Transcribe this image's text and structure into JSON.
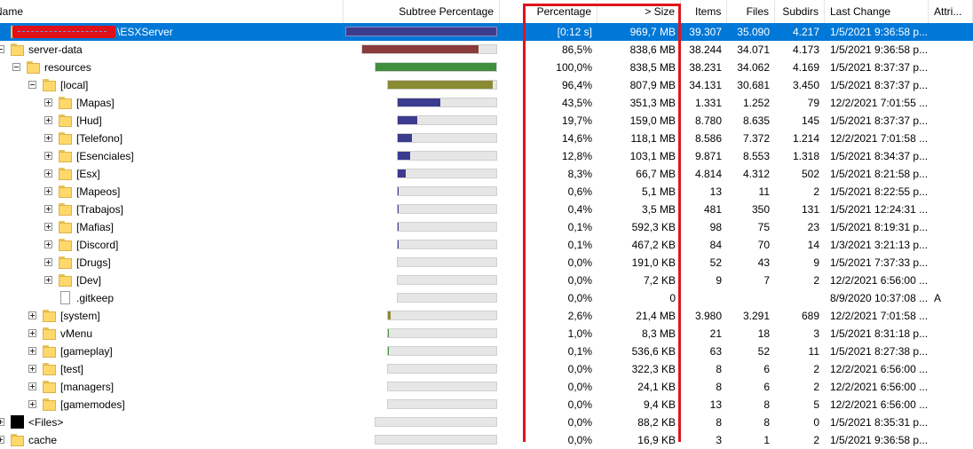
{
  "columns": {
    "name": "Name",
    "subtree": "Subtree Percentage",
    "percentage": "Percentage",
    "size": "> Size",
    "items": "Items",
    "files": "Files",
    "subdirs": "Subdirs",
    "lastchange": "Last Change",
    "attri": "Attri..."
  },
  "colors": {
    "selection": "#0078d7",
    "highlight_box": "#e0141e",
    "bar_root": "#3c3c8c",
    "bar_serverdata": "#8b3a3a",
    "bar_resources": "#3f8f3f",
    "bar_local": "#8a8a32",
    "bar_child": "#3b3b8f"
  },
  "rows": [
    {
      "name": "\\ESXServer",
      "icon": "folder-icon",
      "percentage": "[0:12 s]",
      "size": "969,7 MB",
      "items": "39.307",
      "files": "35.090",
      "subdirs": "4.217",
      "lastchange": "1/5/2021 9:36:58 p...",
      "attr": "",
      "fraction": 1.0,
      "barColor": "#3c3c8c",
      "selected": true
    },
    {
      "name": "server-data",
      "icon": "folder-icon",
      "percentage": "86,5%",
      "size": "838,6 MB",
      "items": "38.244",
      "files": "34.071",
      "subdirs": "4.173",
      "lastchange": "1/5/2021 9:36:58 p...",
      "attr": "",
      "fraction": 0.865,
      "barColor": "#8b3a3a"
    },
    {
      "name": "resources",
      "icon": "folder-icon",
      "percentage": "100,0%",
      "size": "838,5 MB",
      "items": "38.231",
      "files": "34.062",
      "subdirs": "4.169",
      "lastchange": "1/5/2021 8:37:37 p...",
      "attr": "",
      "fraction": 1.0,
      "barColor": "#3f8f3f"
    },
    {
      "name": "[local]",
      "icon": "folder-icon",
      "percentage": "96,4%",
      "size": "807,9 MB",
      "items": "34.131",
      "files": "30.681",
      "subdirs": "3.450",
      "lastchange": "1/5/2021 8:37:37 p...",
      "attr": "",
      "fraction": 0.964,
      "barColor": "#8a8a32"
    },
    {
      "name": "[Mapas]",
      "icon": "folder-icon",
      "percentage": "43,5%",
      "size": "351,3 MB",
      "items": "1.331",
      "files": "1.252",
      "subdirs": "79",
      "lastchange": "12/2/2021 7:01:55 ...",
      "attr": "",
      "fraction": 0.435,
      "barColor": "#3b3b8f"
    },
    {
      "name": "[Hud]",
      "icon": "folder-icon",
      "percentage": "19,7%",
      "size": "159,0 MB",
      "items": "8.780",
      "files": "8.635",
      "subdirs": "145",
      "lastchange": "1/5/2021 8:37:37 p...",
      "attr": "",
      "fraction": 0.197,
      "barColor": "#3b3b8f"
    },
    {
      "name": "[Telefono]",
      "icon": "folder-icon",
      "percentage": "14,6%",
      "size": "118,1 MB",
      "items": "8.586",
      "files": "7.372",
      "subdirs": "1.214",
      "lastchange": "12/2/2021 7:01:58 ...",
      "attr": "",
      "fraction": 0.146,
      "barColor": "#3b3b8f"
    },
    {
      "name": "[Esenciales]",
      "icon": "folder-icon",
      "percentage": "12,8%",
      "size": "103,1 MB",
      "items": "9.871",
      "files": "8.553",
      "subdirs": "1.318",
      "lastchange": "1/5/2021 8:34:37 p...",
      "attr": "",
      "fraction": 0.128,
      "barColor": "#3b3b8f"
    },
    {
      "name": "[Esx]",
      "icon": "folder-icon",
      "percentage": "8,3%",
      "size": "66,7 MB",
      "items": "4.814",
      "files": "4.312",
      "subdirs": "502",
      "lastchange": "1/5/2021 8:21:58 p...",
      "attr": "",
      "fraction": 0.083,
      "barColor": "#3b3b8f"
    },
    {
      "name": "[Mapeos]",
      "icon": "folder-icon",
      "percentage": "0,6%",
      "size": "5,1 MB",
      "items": "13",
      "files": "11",
      "subdirs": "2",
      "lastchange": "1/5/2021 8:22:55 p...",
      "attr": "",
      "fraction": 0.006,
      "barColor": "#3b3b8f"
    },
    {
      "name": "[Trabajos]",
      "icon": "folder-icon",
      "percentage": "0,4%",
      "size": "3,5 MB",
      "items": "481",
      "files": "350",
      "subdirs": "131",
      "lastchange": "1/5/2021 12:24:31 ...",
      "attr": "",
      "fraction": 0.004,
      "barColor": "#3b3b8f"
    },
    {
      "name": "[Mafias]",
      "icon": "folder-icon",
      "percentage": "0,1%",
      "size": "592,3 KB",
      "items": "98",
      "files": "75",
      "subdirs": "23",
      "lastchange": "1/5/2021 8:19:31 p...",
      "attr": "",
      "fraction": 0.001,
      "barColor": "#3b3b8f"
    },
    {
      "name": "[Discord]",
      "icon": "folder-icon",
      "percentage": "0,1%",
      "size": "467,2 KB",
      "items": "84",
      "files": "70",
      "subdirs": "14",
      "lastchange": "1/3/2021 3:21:13 p...",
      "attr": "",
      "fraction": 0.001,
      "barColor": "#3b3b8f"
    },
    {
      "name": "[Drugs]",
      "icon": "folder-icon",
      "percentage": "0,0%",
      "size": "191,0 KB",
      "items": "52",
      "files": "43",
      "subdirs": "9",
      "lastchange": "1/5/2021 7:37:33 p...",
      "attr": "",
      "fraction": 0.0,
      "barColor": "#3b3b8f"
    },
    {
      "name": "[Dev]",
      "icon": "folder-icon",
      "percentage": "0,0%",
      "size": "7,2 KB",
      "items": "9",
      "files": "7",
      "subdirs": "2",
      "lastchange": "12/2/2021 6:56:00 ...",
      "attr": "",
      "fraction": 0.0,
      "barColor": "#3b3b8f"
    },
    {
      "name": ".gitkeep",
      "icon": "file-icon",
      "percentage": "0,0%",
      "size": "0",
      "items": "",
      "files": "",
      "subdirs": "",
      "lastchange": "8/9/2020 10:37:08 ...",
      "attr": "A",
      "fraction": 0.0,
      "barColor": "#3b3b8f"
    },
    {
      "name": "[system]",
      "icon": "folder-icon",
      "percentage": "2,6%",
      "size": "21,4 MB",
      "items": "3.980",
      "files": "3.291",
      "subdirs": "689",
      "lastchange": "12/2/2021 7:01:58 ...",
      "attr": "",
      "fraction": 0.026,
      "barColor": "#8a8a32"
    },
    {
      "name": "vMenu",
      "icon": "folder-icon",
      "percentage": "1,0%",
      "size": "8,3 MB",
      "items": "21",
      "files": "18",
      "subdirs": "3",
      "lastchange": "1/5/2021 8:31:18 p...",
      "attr": "",
      "fraction": 0.01,
      "barColor": "#3f8f3f"
    },
    {
      "name": "[gameplay]",
      "icon": "folder-icon",
      "percentage": "0,1%",
      "size": "536,6 KB",
      "items": "63",
      "files": "52",
      "subdirs": "11",
      "lastchange": "1/5/2021 8:27:38 p...",
      "attr": "",
      "fraction": 0.001,
      "barColor": "#3f8f3f"
    },
    {
      "name": "[test]",
      "icon": "folder-icon",
      "percentage": "0,0%",
      "size": "322,3 KB",
      "items": "8",
      "files": "6",
      "subdirs": "2",
      "lastchange": "12/2/2021 6:56:00 ...",
      "attr": "",
      "fraction": 0.0,
      "barColor": "#3f8f3f"
    },
    {
      "name": "[managers]",
      "icon": "folder-icon",
      "percentage": "0,0%",
      "size": "24,1 KB",
      "items": "8",
      "files": "6",
      "subdirs": "2",
      "lastchange": "12/2/2021 6:56:00 ...",
      "attr": "",
      "fraction": 0.0,
      "barColor": "#3f8f3f"
    },
    {
      "name": "[gamemodes]",
      "icon": "folder-icon",
      "percentage": "0,0%",
      "size": "9,4 KB",
      "items": "13",
      "files": "8",
      "subdirs": "5",
      "lastchange": "12/2/2021 6:56:00 ...",
      "attr": "",
      "fraction": 0.0,
      "barColor": "#3f8f3f"
    },
    {
      "name": "<Files>",
      "icon": "files-icon",
      "percentage": "0,0%",
      "size": "88,2 KB",
      "items": "8",
      "files": "8",
      "subdirs": "0",
      "lastchange": "1/5/2021 8:35:31 p...",
      "attr": "",
      "fraction": 0.0,
      "barColor": "#8b3a3a"
    },
    {
      "name": "cache",
      "icon": "folder-icon",
      "percentage": "0,0%",
      "size": "16,9 KB",
      "items": "3",
      "files": "1",
      "subdirs": "2",
      "lastchange": "1/5/2021 9:36:58 p...",
      "attr": "",
      "fraction": 0.0,
      "barColor": "#8b3a3a"
    }
  ]
}
